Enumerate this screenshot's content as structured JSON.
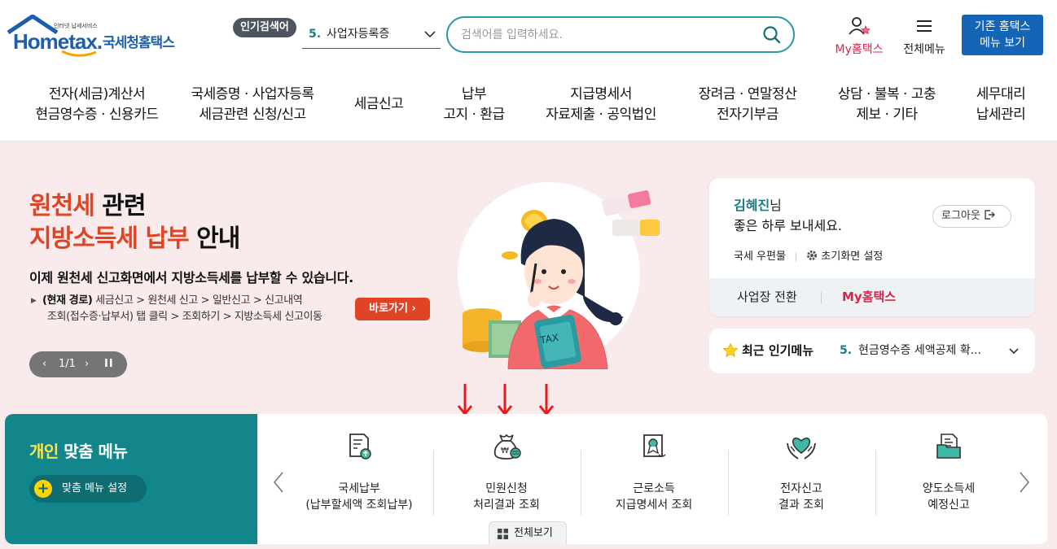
{
  "header": {
    "logo_small": "인터넷 납세서비스",
    "logo_word": "Hometax.",
    "logo_kor": "국세청홈택스",
    "popular_badge": "인기검색어",
    "popular_rank": "5.",
    "popular_term": "사업자등록증",
    "search_placeholder": "검색어를 입력하세요.",
    "my_hometax": "My홈택스",
    "all_menu": "전체메뉴",
    "old_home_line1": "기존 홈택스",
    "old_home_line2": "메뉴 보기"
  },
  "gnb": [
    {
      "line1": "전자(세금)계산서",
      "line2": "현금영수증 · 신용카드"
    },
    {
      "line1": "국세증명 · 사업자등록",
      "line2": "세금관련 신청/신고"
    },
    {
      "line1": "세금신고",
      "line2": ""
    },
    {
      "line1": "납부",
      "line2": "고지 · 환급"
    },
    {
      "line1": "지급명세서",
      "line2": "자료제출 · 공익법인"
    },
    {
      "line1": "장려금 · 연말정산",
      "line2": "전자기부금"
    },
    {
      "line1": "상담 · 불복 · 고충",
      "line2": "제보 · 기타"
    },
    {
      "line1": "세무대리",
      "line2": "납세관리"
    }
  ],
  "hero": {
    "title1_red": "원천세",
    "title1_dark": " 관련",
    "title2_red": "지방소득세 납부",
    "title2_dark": " 안내",
    "desc": "이제 원천세 신고화면에서 지방소득세를 납부할 수 있습니다.",
    "path_label": "(현재 경로)",
    "path_line1": " 세금신고 > 원천세 신고 > 일반신고 > 신고내역",
    "path_line2": "조회(접수증·납부서) 탭 클릭 > 조회하기 > 지방소득세 신고이동",
    "go_button": "바로가기",
    "pager": "1/1",
    "illus_text": "TAX"
  },
  "login": {
    "name": "김혜진",
    "suffix": "님",
    "greeting": "좋은 하루 보내세요.",
    "logout": "로그아웃",
    "mailbox": "국세 우편물",
    "init_setting": "초기화면 설정",
    "switch_biz": "사업장 전환",
    "my_hometax": "My홈택스"
  },
  "recent": {
    "title": "최근 인기메뉴",
    "rank": "5.",
    "item": "현금영수증 세액공제 확..."
  },
  "custom_menu": {
    "title_yellow": "개인",
    "title_white": " 맞춤 메뉴",
    "setting": "맞춤 메뉴 설정",
    "items": [
      {
        "line1": "국세납부",
        "line2": "(납부할세액 조회납부)",
        "icon": "tax-payment-icon"
      },
      {
        "line1": "민원신청",
        "line2": "처리결과 조회",
        "icon": "money-bag-icon"
      },
      {
        "line1": "근로소득",
        "line2": "지급명세서 조회",
        "icon": "certificate-icon"
      },
      {
        "line1": "전자신고",
        "line2": "결과 조회",
        "icon": "heart-hands-icon"
      },
      {
        "line1": "양도소득세",
        "line2": "예정신고",
        "icon": "document-folder-icon"
      }
    ],
    "view_all": "전체보기"
  },
  "colors": {
    "brand_blue": "#1565b7",
    "teal": "#13868c",
    "accent_red": "#e04424",
    "hero_bg": "#f9ebec"
  }
}
